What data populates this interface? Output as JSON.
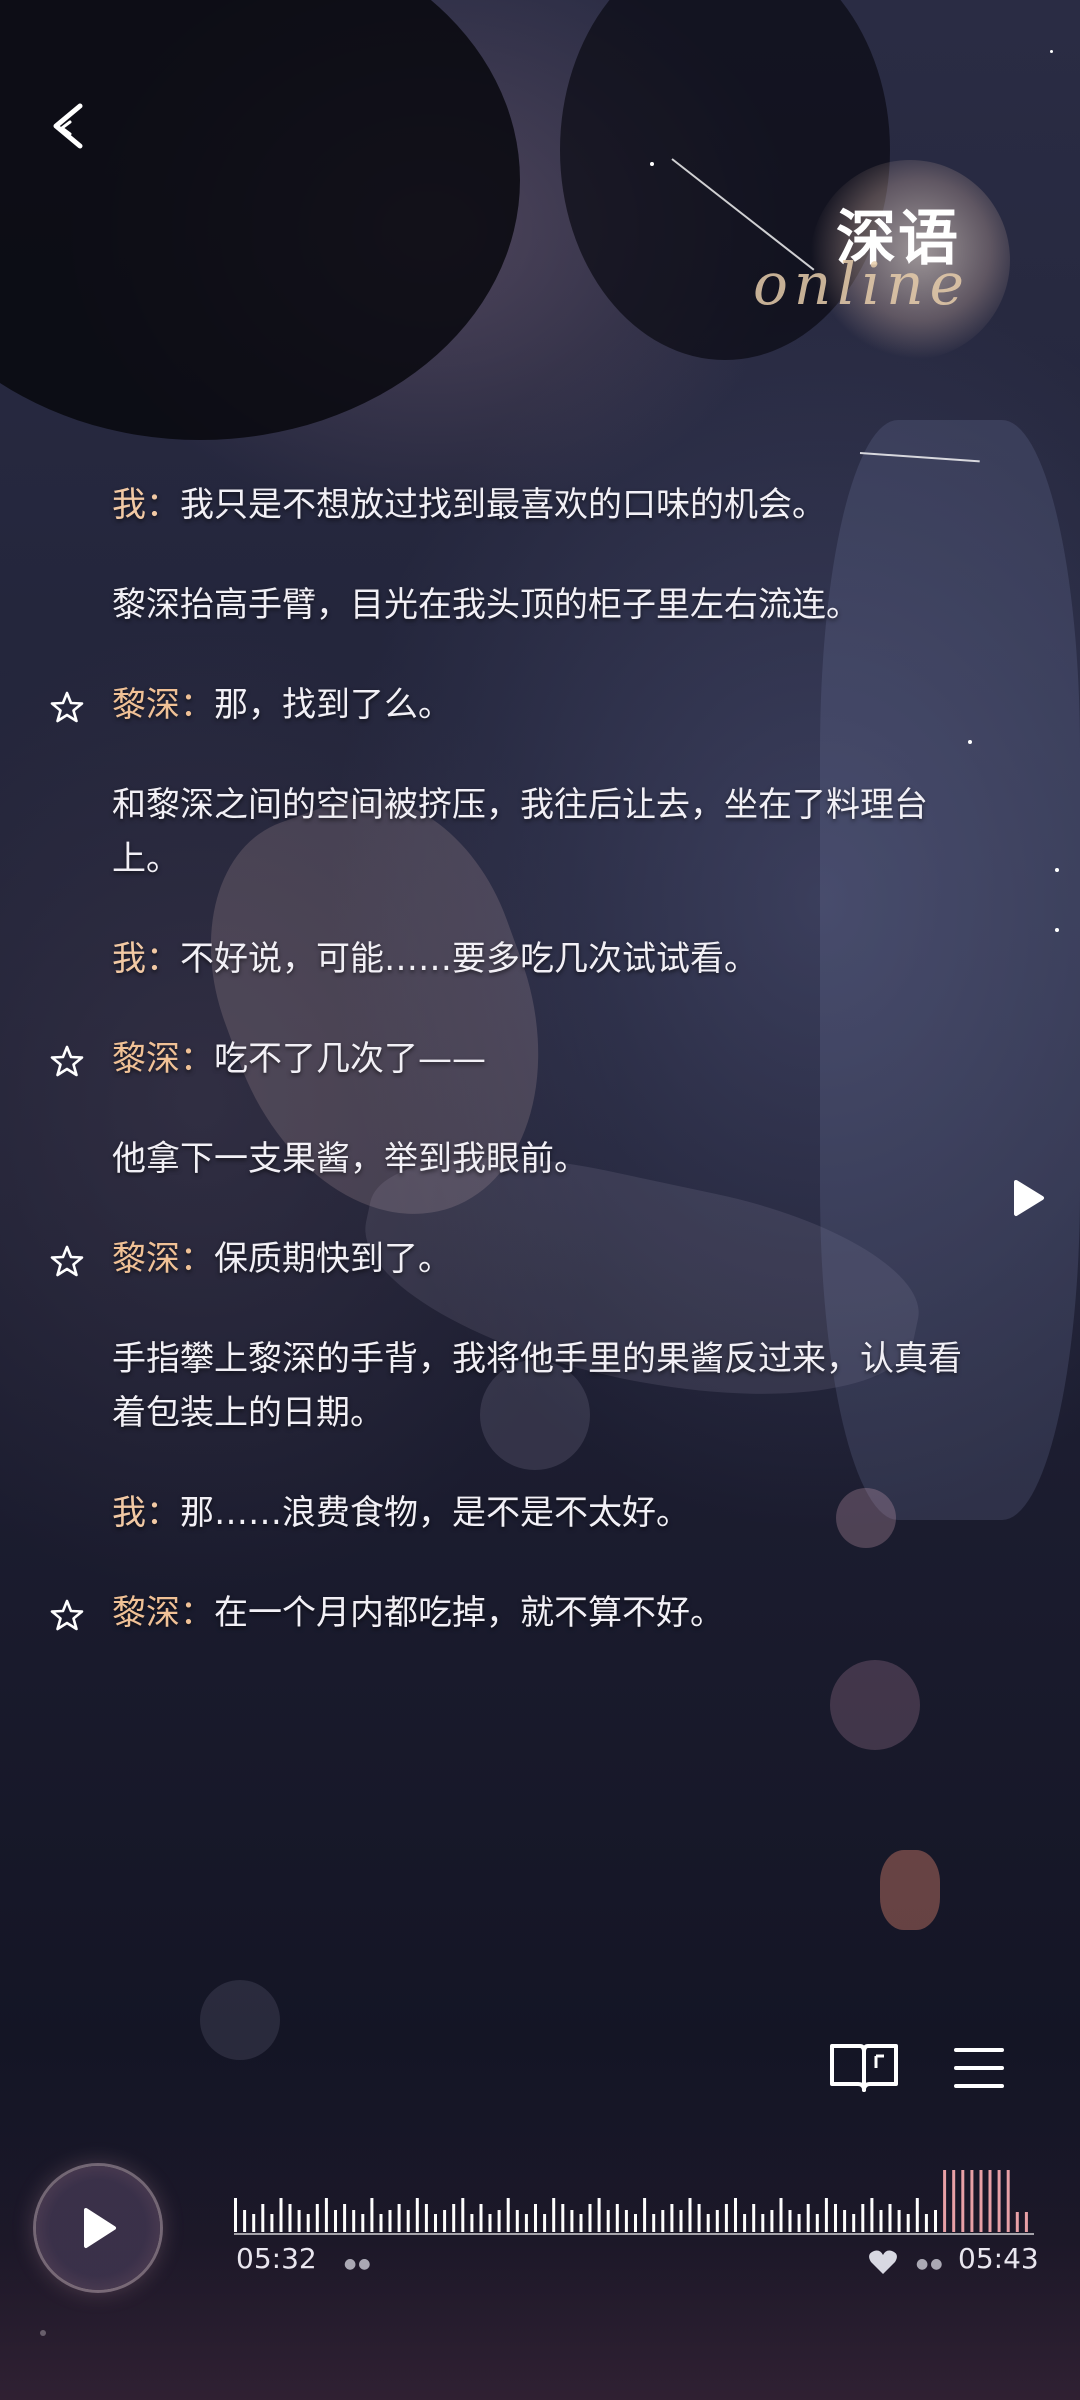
{
  "header": {
    "back_icon": "chevron-left-icon",
    "logo_title": "深语",
    "logo_script": "online"
  },
  "dialogue": [
    {
      "starred": false,
      "speaker": "我：",
      "text": "我只是不想放过找到最喜欢的口味的机会。"
    },
    {
      "starred": false,
      "speaker": "",
      "text": "黎深抬高手臂，目光在我头顶的柜子里左右流连。"
    },
    {
      "starred": true,
      "speaker": "黎深：",
      "text": "那，找到了么。"
    },
    {
      "starred": false,
      "speaker": "",
      "text": "和黎深之间的空间被挤压，我往后让去，坐在了料理台上。"
    },
    {
      "starred": false,
      "speaker": "我：",
      "text": "不好说，可能……要多吃几次试试看。"
    },
    {
      "starred": true,
      "speaker": "黎深：",
      "text": "吃不了几次了——"
    },
    {
      "starred": false,
      "speaker": "",
      "text": "他拿下一支果酱，举到我眼前。"
    },
    {
      "starred": true,
      "speaker": "黎深：",
      "text": "保质期快到了。"
    },
    {
      "starred": false,
      "speaker": "",
      "text": "手指攀上黎深的手背，我将他手里的果酱反过来，认真看着包装上的日期。"
    },
    {
      "starred": false,
      "speaker": "我：",
      "text": "那……浪费食物，是不是不太好。"
    },
    {
      "starred": true,
      "speaker": "黎深：",
      "text": "在一个月内都吃掉，就不算不好。"
    }
  ],
  "toolbar": {
    "book_icon": "book-icon",
    "menu_icon": "menu-icon"
  },
  "player": {
    "current_time": "05:32",
    "total_time": "05:43",
    "progress": 0.968,
    "play_icon": "play-icon",
    "heart_icon": "heart-icon"
  },
  "colors": {
    "speaker": "#f0c196",
    "text": "#f2f0f6",
    "wave_played": "#ffffff",
    "wave_remaining": "#e8a0a6"
  }
}
